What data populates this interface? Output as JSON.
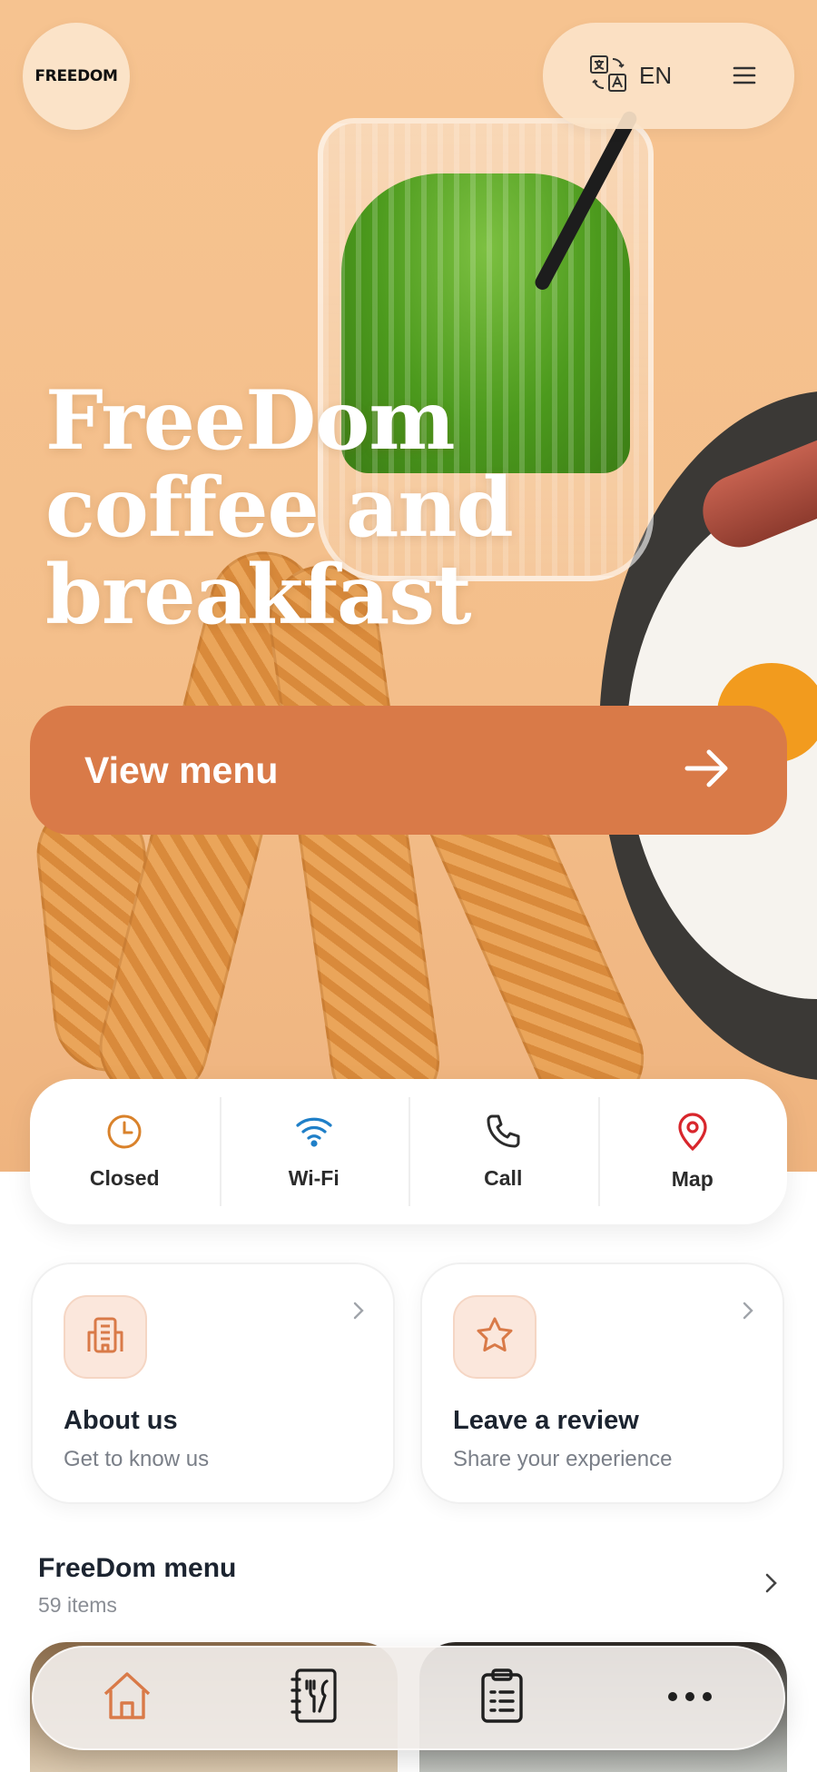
{
  "header": {
    "logo_text": "FREEDOM",
    "language": "EN"
  },
  "hero": {
    "title_line1": "FreeDom",
    "title_line2": "coffee and",
    "title_line3": "breakfast",
    "cta_label": "View menu"
  },
  "quick_actions": [
    {
      "label": "Closed",
      "icon": "clock-icon",
      "color": "#d9822b"
    },
    {
      "label": "Wi-Fi",
      "icon": "wifi-icon",
      "color": "#1f7fc8"
    },
    {
      "label": "Call",
      "icon": "phone-icon",
      "color": "#2b2b2b"
    },
    {
      "label": "Map",
      "icon": "map-pin-icon",
      "color": "#d8262c"
    }
  ],
  "cards": [
    {
      "title": "About us",
      "subtitle": "Get to know us",
      "icon": "building-icon"
    },
    {
      "title": "Leave a review",
      "subtitle": "Share your experience",
      "icon": "star-icon"
    }
  ],
  "menu_section": {
    "title": "FreeDom menu",
    "count": "59 items"
  },
  "bottom_nav": [
    {
      "name": "home",
      "icon": "home-icon",
      "active": true
    },
    {
      "name": "menu",
      "icon": "menu-book-icon",
      "active": false
    },
    {
      "name": "orders",
      "icon": "clipboard-icon",
      "active": false
    },
    {
      "name": "more",
      "icon": "more-dots-icon",
      "active": false
    }
  ],
  "colors": {
    "accent": "#d97a48",
    "hero_bg": "#f6c390"
  }
}
